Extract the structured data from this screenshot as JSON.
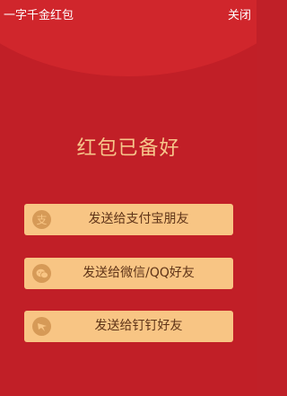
{
  "topbar": {
    "title": "一字千金红包",
    "close_label": "关闭"
  },
  "main": {
    "headline": "红包已备好",
    "share_buttons": [
      {
        "label": "发送给支付宝朋友",
        "icon": "alipay-icon"
      },
      {
        "label": "发送给微信/QQ好友",
        "icon": "wechat-icon"
      },
      {
        "label": "发送给钉钉好友",
        "icon": "dingtalk-icon"
      }
    ]
  },
  "colors": {
    "background": "#c11f27",
    "arc": "#d0262c",
    "headline": "#f6c58a",
    "button": "#f8c584",
    "button_icon": "#d69a57",
    "button_text": "#5f3418"
  }
}
